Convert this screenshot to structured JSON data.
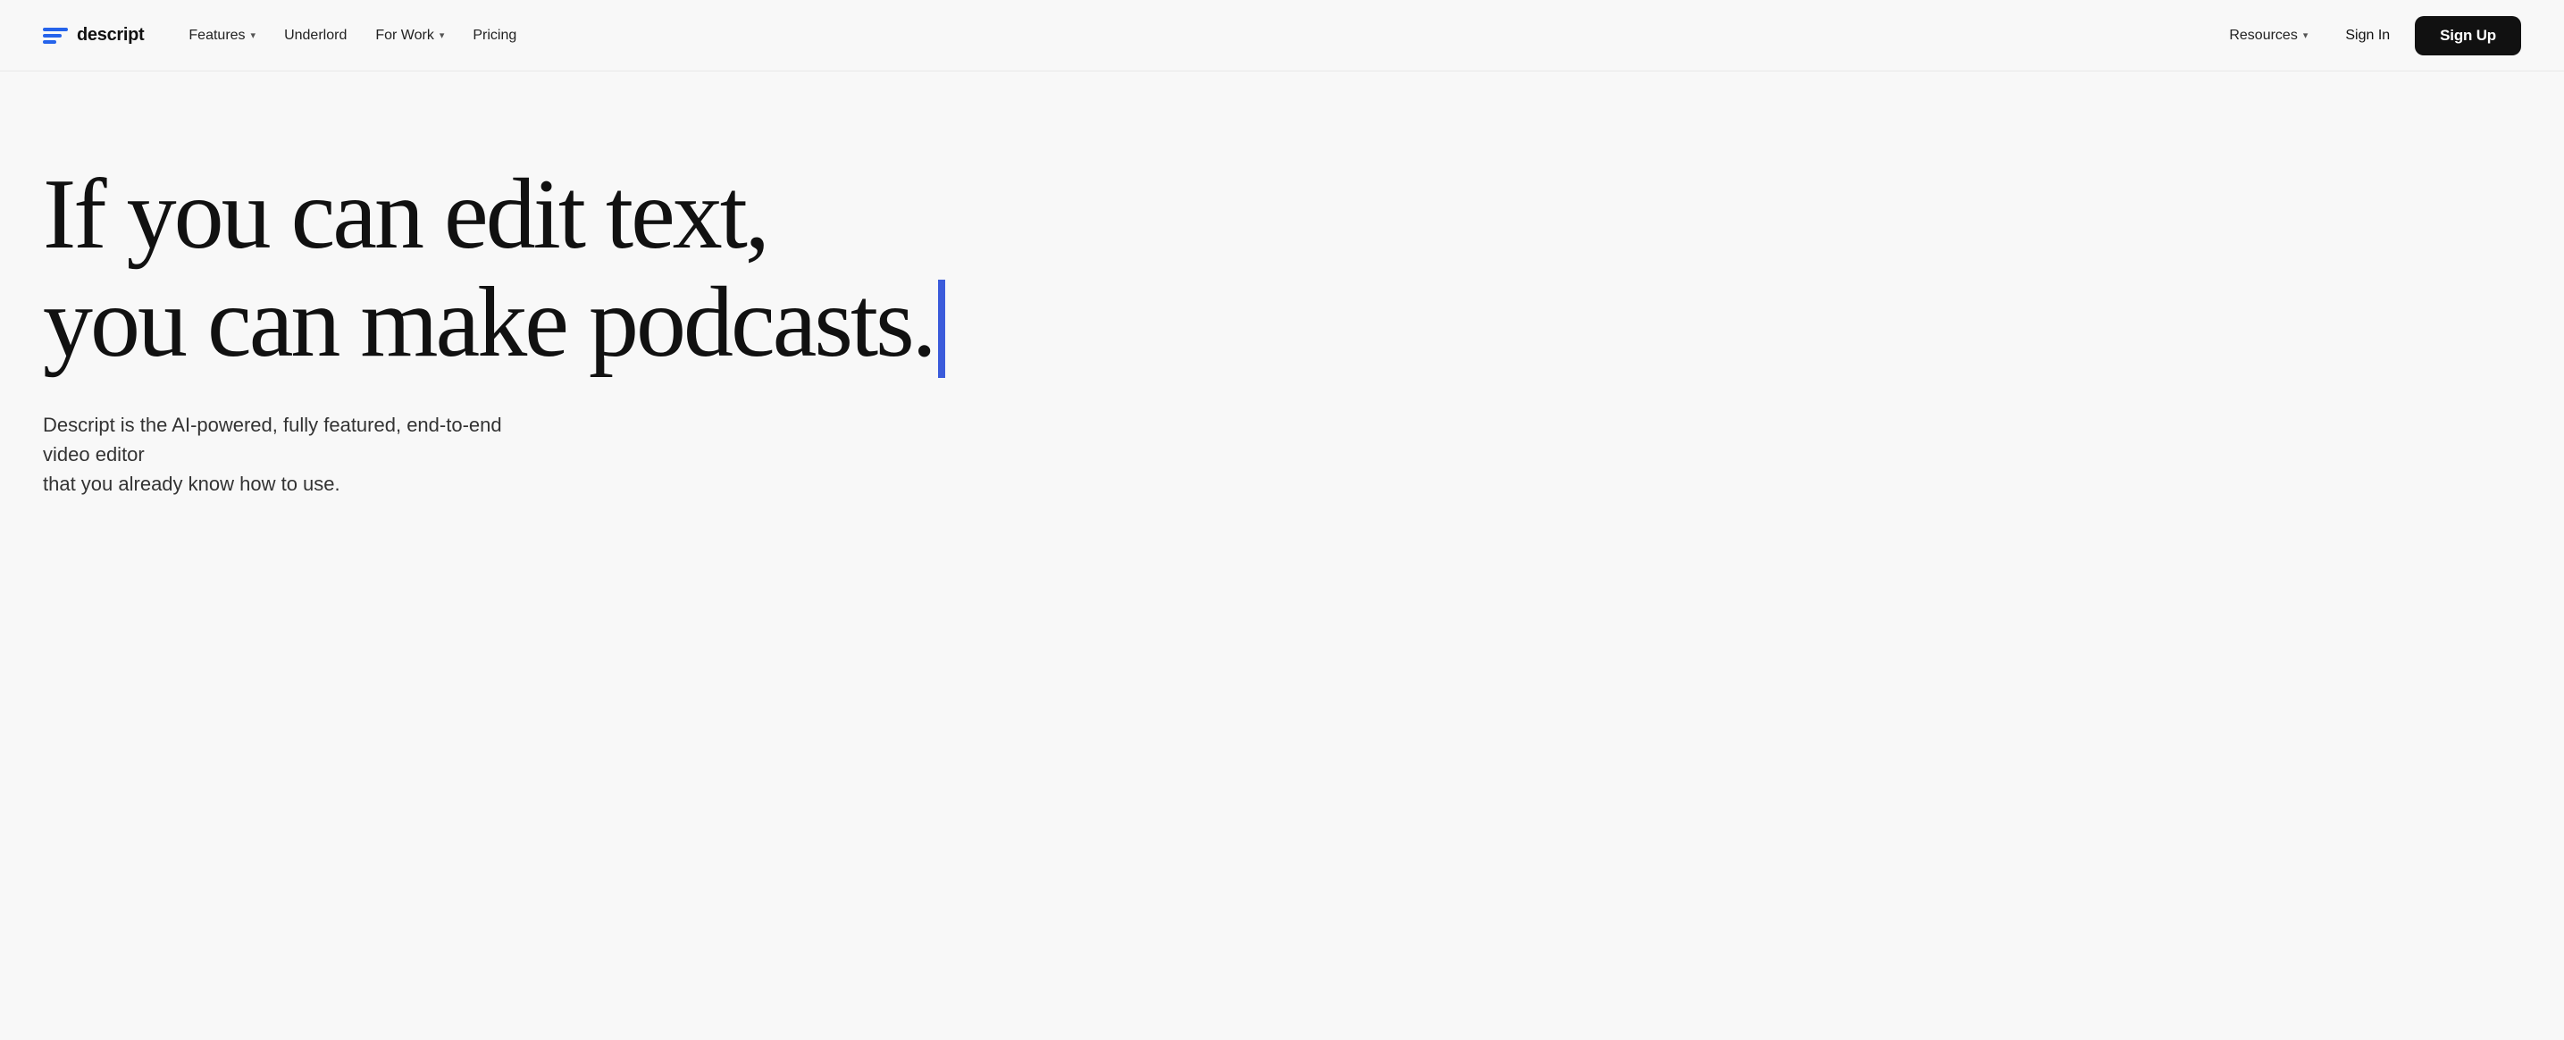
{
  "brand": {
    "logo_text": "descript",
    "logo_icon_alt": "descript-logo"
  },
  "nav": {
    "left_links": [
      {
        "id": "features",
        "label": "Features",
        "has_dropdown": true
      },
      {
        "id": "underlord",
        "label": "Underlord",
        "has_dropdown": false
      },
      {
        "id": "for-work",
        "label": "For Work",
        "has_dropdown": true
      },
      {
        "id": "pricing",
        "label": "Pricing",
        "has_dropdown": false
      }
    ],
    "right_links": [
      {
        "id": "resources",
        "label": "Resources",
        "has_dropdown": true
      },
      {
        "id": "sign-in",
        "label": "Sign In",
        "has_dropdown": false
      },
      {
        "id": "sign-up",
        "label": "Sign Up",
        "has_dropdown": false
      }
    ]
  },
  "hero": {
    "headline_line1": "If you can edit text,",
    "headline_line2": "you can make podcasts.",
    "subtext_line1": "Descript is the AI-powered, fully featured, end-to-end video editor",
    "subtext_line2": "that you already know how to use.",
    "cursor_color": "#3b5bdb"
  }
}
